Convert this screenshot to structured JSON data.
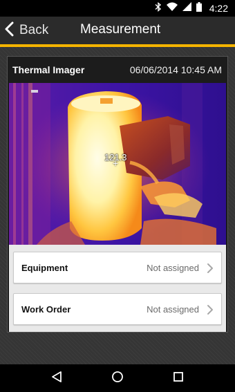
{
  "status_bar": {
    "time": "4:22",
    "icons": [
      "bluetooth-icon",
      "wifi-icon",
      "cell-signal-icon",
      "battery-icon"
    ]
  },
  "app_bar": {
    "back_label": "Back",
    "title": "Measurement",
    "accent_color": "#f5b400"
  },
  "card": {
    "title": "Thermal Imager",
    "datetime": "06/06/2014 10:45 AM",
    "image": {
      "spot_temperature": "121.3"
    }
  },
  "details": {
    "rows": [
      {
        "label": "Equipment",
        "value": "Not assigned"
      },
      {
        "label": "Work Order",
        "value": "Not assigned"
      }
    ]
  },
  "nav_bar": {
    "buttons": [
      "back-triangle-icon",
      "home-circle-icon",
      "recents-square-icon"
    ]
  }
}
